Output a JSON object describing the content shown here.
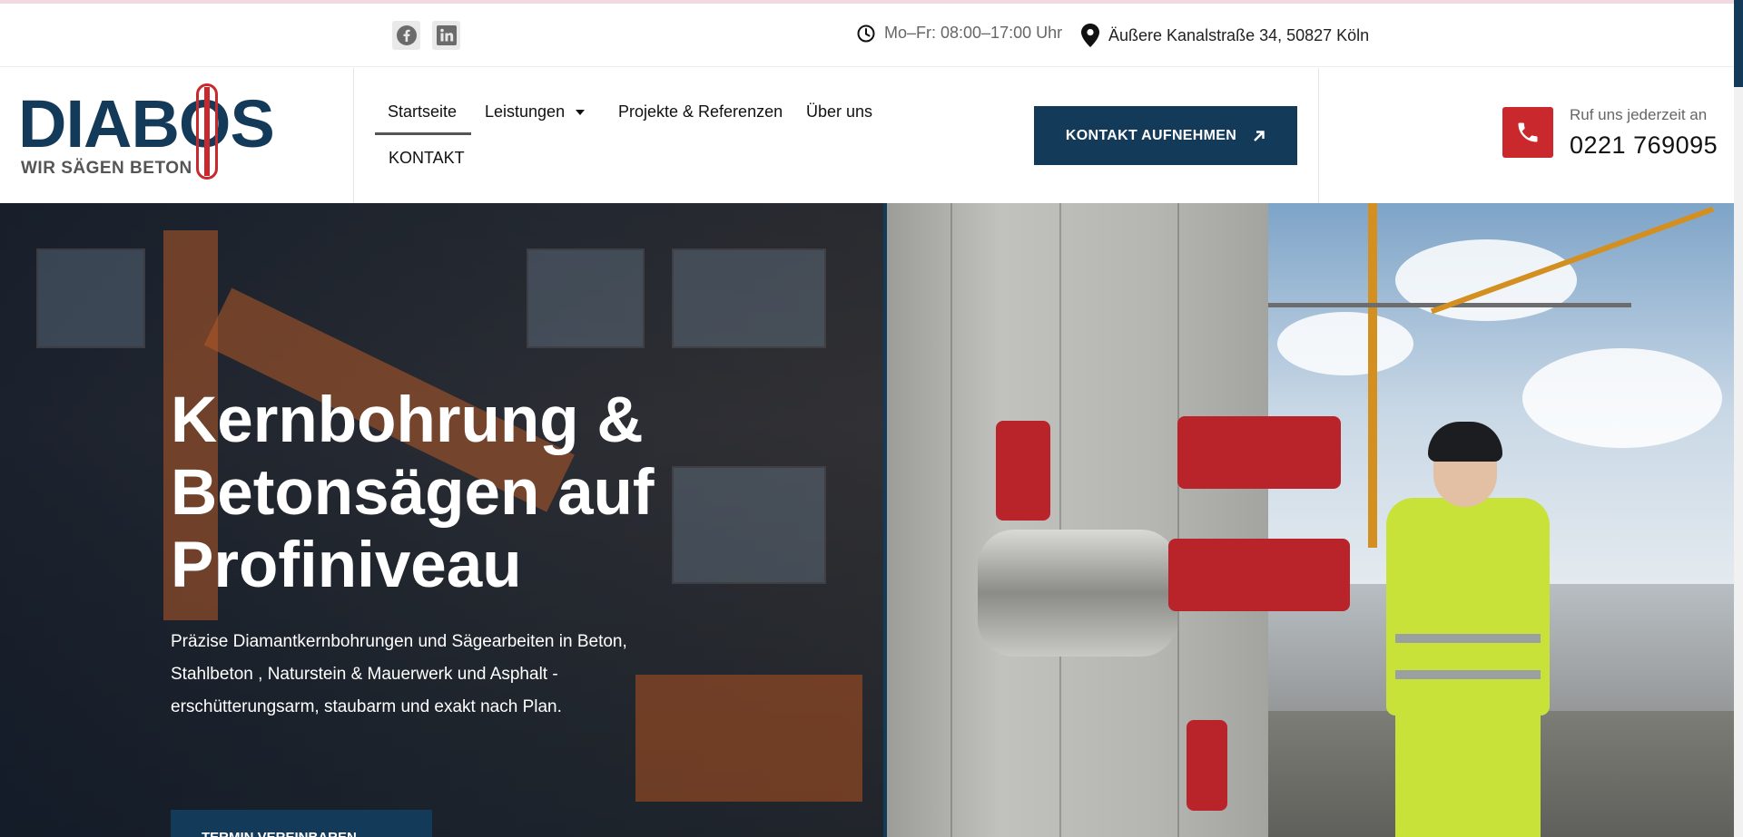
{
  "topbar": {
    "social": [
      {
        "name": "facebook-icon"
      },
      {
        "name": "linkedin-icon"
      }
    ],
    "hours": "Mo–Fr: 08:00–17:00 Uhr",
    "address": "Äußere Kanalstraße 34, 50827 Köln"
  },
  "header": {
    "logo_text": "DIABOS",
    "logo_tagline": "WIR SÄGEN BETON",
    "nav": {
      "home": "Startseite",
      "services": "Leistungen",
      "projects": "Projekte & Referenzen",
      "about": "Über uns",
      "contact": "KONTAKT"
    },
    "cta_label": "KONTAKT AUFNEHMEN",
    "phone_label": "Ruf uns jederzeit an",
    "phone_number": "0221 769095"
  },
  "hero": {
    "title": "Kernbohrung & Betonsägen auf Profiniveau",
    "text": "Präzise Diamantkernbohrungen und Sägearbeiten in Beton, Stahlbeton , Naturstein & Mauerwerk und Asphalt - erschütterungsarm, staubarm und exakt nach Plan.",
    "button_label": "TERMIN VEREINBAREN"
  },
  "colors": {
    "brand_navy": "#143a5a",
    "brand_red": "#c9282c"
  }
}
